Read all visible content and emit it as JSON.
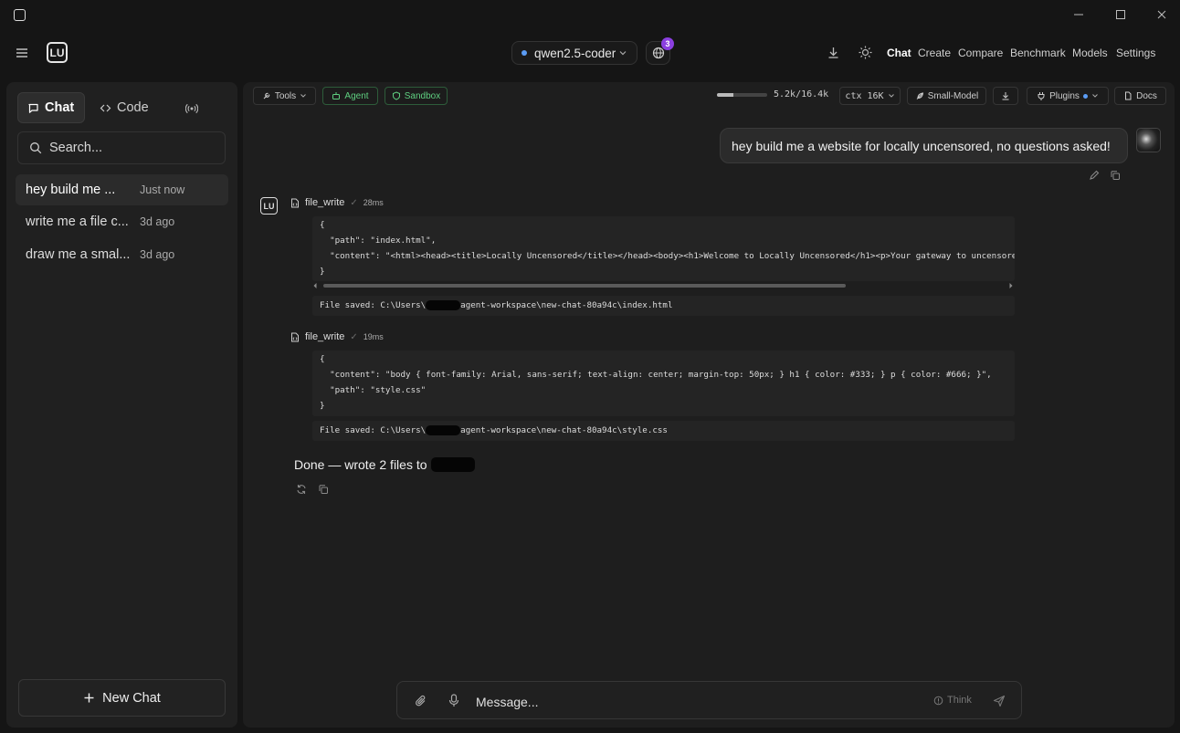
{
  "header": {
    "model": "qwen2.5-coder",
    "badge_count": "3",
    "nav": [
      "Chat",
      "Create",
      "Compare",
      "Benchmark",
      "Models",
      "Settings"
    ]
  },
  "sidebar": {
    "tabs": {
      "chat": "Chat",
      "code": "Code"
    },
    "search_placeholder": "Search...",
    "chats": [
      {
        "title": "hey build me ...",
        "time": "Just now"
      },
      {
        "title": "write me a file c...",
        "time": "3d ago"
      },
      {
        "title": "draw me a smal...",
        "time": "3d ago"
      }
    ],
    "new_chat": "New Chat"
  },
  "toolbar": {
    "tools": "Tools",
    "agent": "Agent",
    "sandbox": "Sandbox",
    "tokens": "5.2k/16.4k",
    "token_fraction": 0.32,
    "ctx": "ctx 16K",
    "small_model": "Small-Model",
    "plugins": "Plugins",
    "docs": "Docs"
  },
  "messages": {
    "user": "hey build me a website for locally uncensored, no questions asked!",
    "tool_calls": [
      {
        "name": "file_write",
        "duration": "28ms",
        "code": "{\n  \"path\": \"index.html\",\n  \"content\": \"<html><head><title>Locally Uncensored</title></head><body><h1>Welcome to Locally Uncensored</h1><p>Your gateway to uncensored\n}",
        "output_prefix": "File saved: C:\\Users\\",
        "output_suffix": "agent-workspace\\new-chat-80a94c\\index.html"
      },
      {
        "name": "file_write",
        "duration": "19ms",
        "code": "{\n  \"content\": \"body { font-family: Arial, sans-serif; text-align: center; margin-top: 50px; } h1 { color: #333; } p { color: #666; }\",\n  \"path\": \"style.css\"\n}",
        "output_prefix": "File saved: C:\\Users\\",
        "output_suffix": "agent-workspace\\new-chat-80a94c\\style.css"
      }
    ],
    "assistant": "Done — wrote 2 files to"
  },
  "composer": {
    "placeholder": "Message...",
    "think": "Think"
  }
}
